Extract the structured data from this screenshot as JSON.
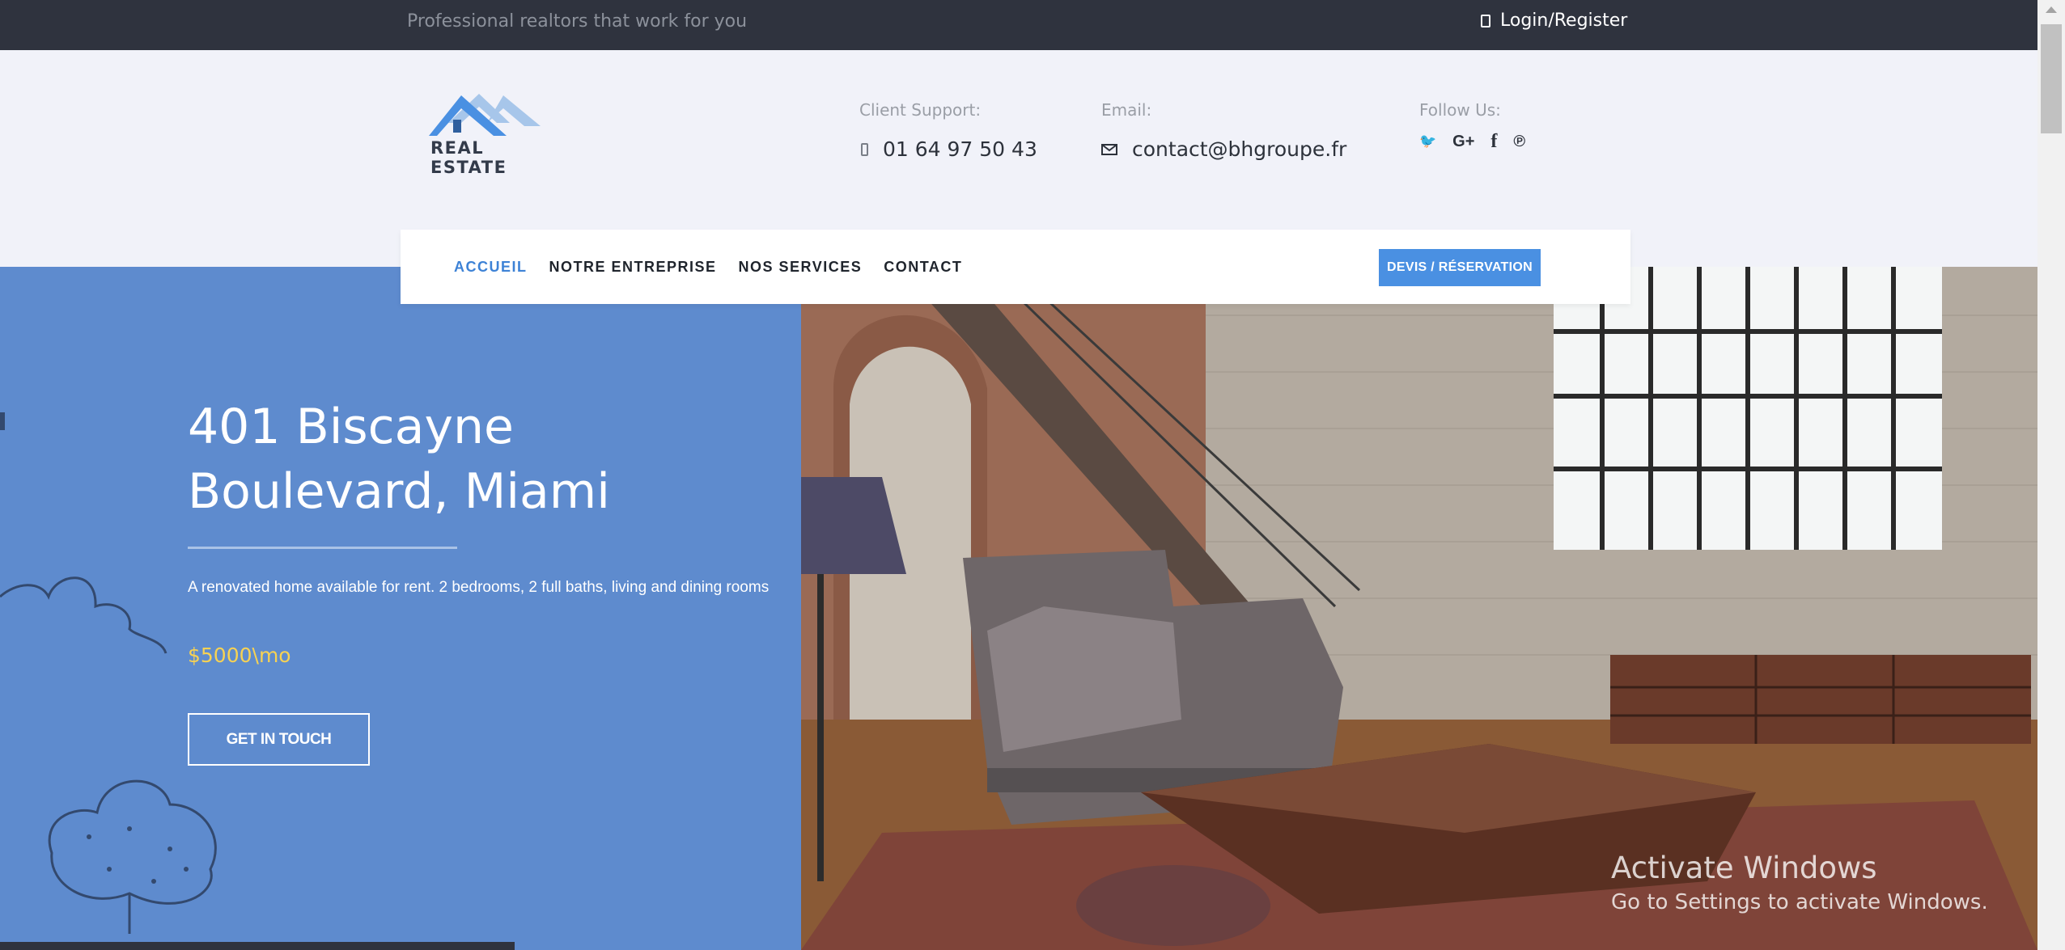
{
  "topbar": {
    "tagline": "Professional realtors that work for you",
    "login_label": "Login/Register",
    "login_icon": "user-icon"
  },
  "header": {
    "logo_text": "REAL ESTATE",
    "support_label": "Client Support:",
    "support_phone": "01 64 97 50 43",
    "email_label": "Email:",
    "email_value": "contact@bhgroupe.fr",
    "follow_label": "Follow Us:",
    "social_icons": [
      "twitter-icon",
      "google-plus-icon",
      "facebook-icon",
      "pinterest-icon"
    ],
    "social_glyphs": {
      "twitter": "🐦",
      "google": "G+",
      "facebook": "f",
      "pinterest": "℗"
    }
  },
  "nav": {
    "items": [
      {
        "label": "ACCUEIL",
        "active": true
      },
      {
        "label": "NOTRE ENTREPRISE",
        "active": false
      },
      {
        "label": "NOS SERVICES",
        "active": false
      },
      {
        "label": "CONTACT",
        "active": false
      }
    ],
    "cta_label": "DEVIS / RÉSERVATION"
  },
  "hero": {
    "title": "401 Biscayne Boulevard, Miami",
    "description": "A renovated home available for rent. 2 bedrooms, 2 full baths, living and dining rooms",
    "price": "$5000\\mo",
    "button_label": "GET IN TOUCH"
  },
  "watermark": {
    "line1": "Activate Windows",
    "line2": "Go to Settings to activate Windows."
  },
  "colors": {
    "topbar": "#2f333e",
    "accent": "#4a90e2",
    "hero_bg": "#5e8bce",
    "price": "#f7d253"
  }
}
